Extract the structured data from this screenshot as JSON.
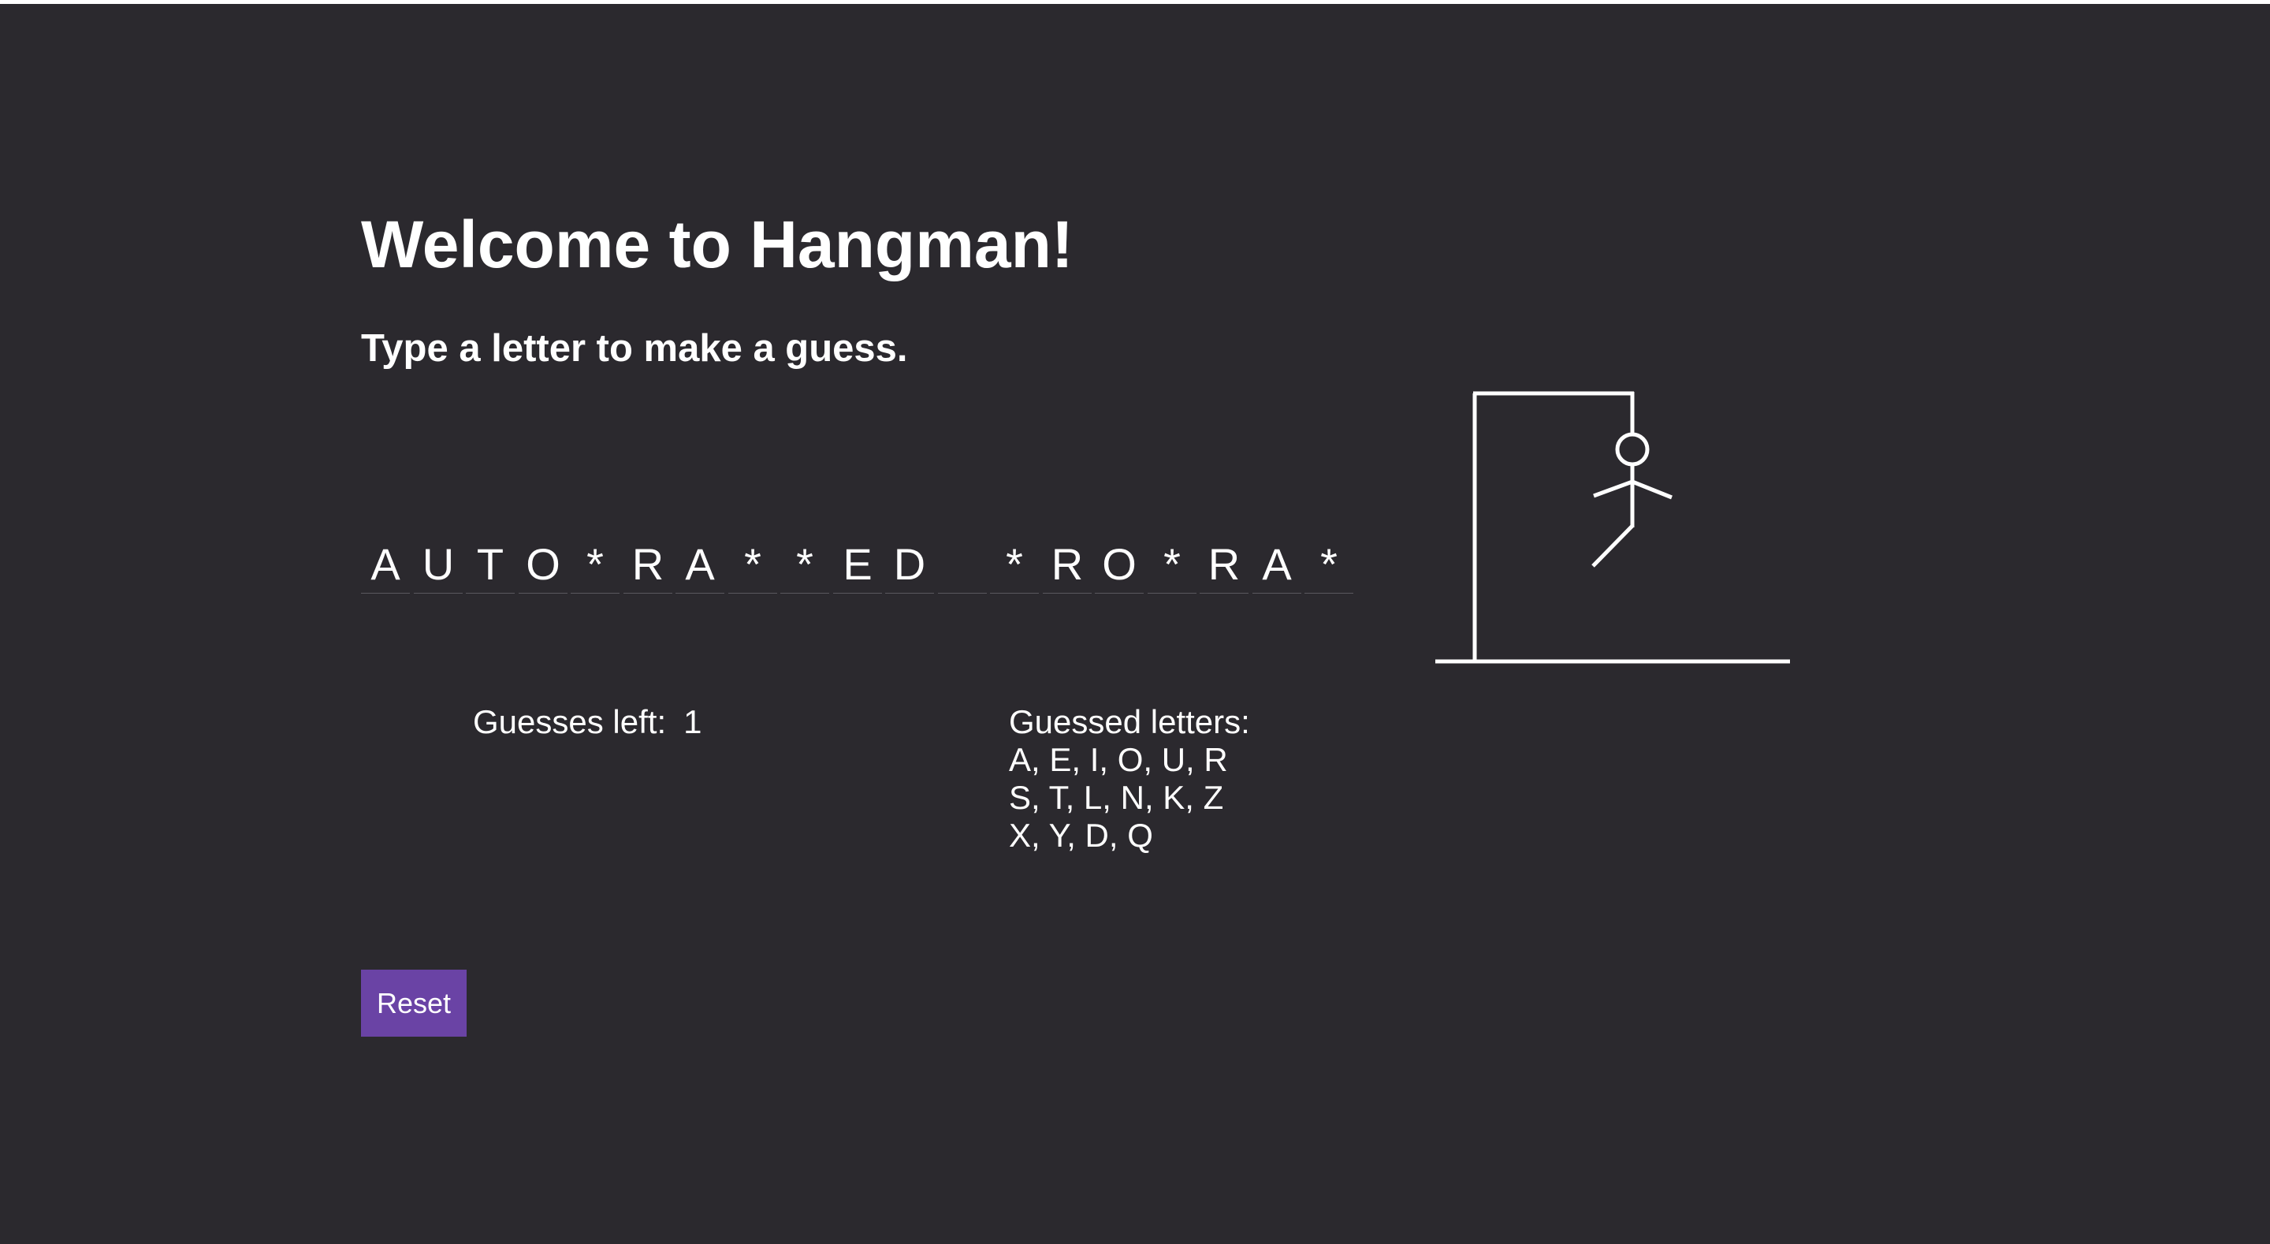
{
  "title": "Welcome to Hangman!",
  "instruction": "Type a letter to make a guess.",
  "word_slots": [
    "A",
    "U",
    "T",
    "O",
    "*",
    "R",
    "A",
    "*",
    "*",
    "E",
    "D",
    "",
    "*",
    "R",
    "O",
    "*",
    "R",
    "A",
    "*"
  ],
  "status": {
    "guesses_left_label": "Guesses left:",
    "guesses_left_value": "1"
  },
  "guessed": {
    "label": "Guessed letters:",
    "lines": [
      "A, E, I, O, U, R",
      "S, T, L, N, K, Z",
      "X, Y, D, Q"
    ]
  },
  "reset_label": "Reset",
  "colors": {
    "background": "#2b292e",
    "button": "#6a43a5",
    "text": "#ffffff"
  }
}
